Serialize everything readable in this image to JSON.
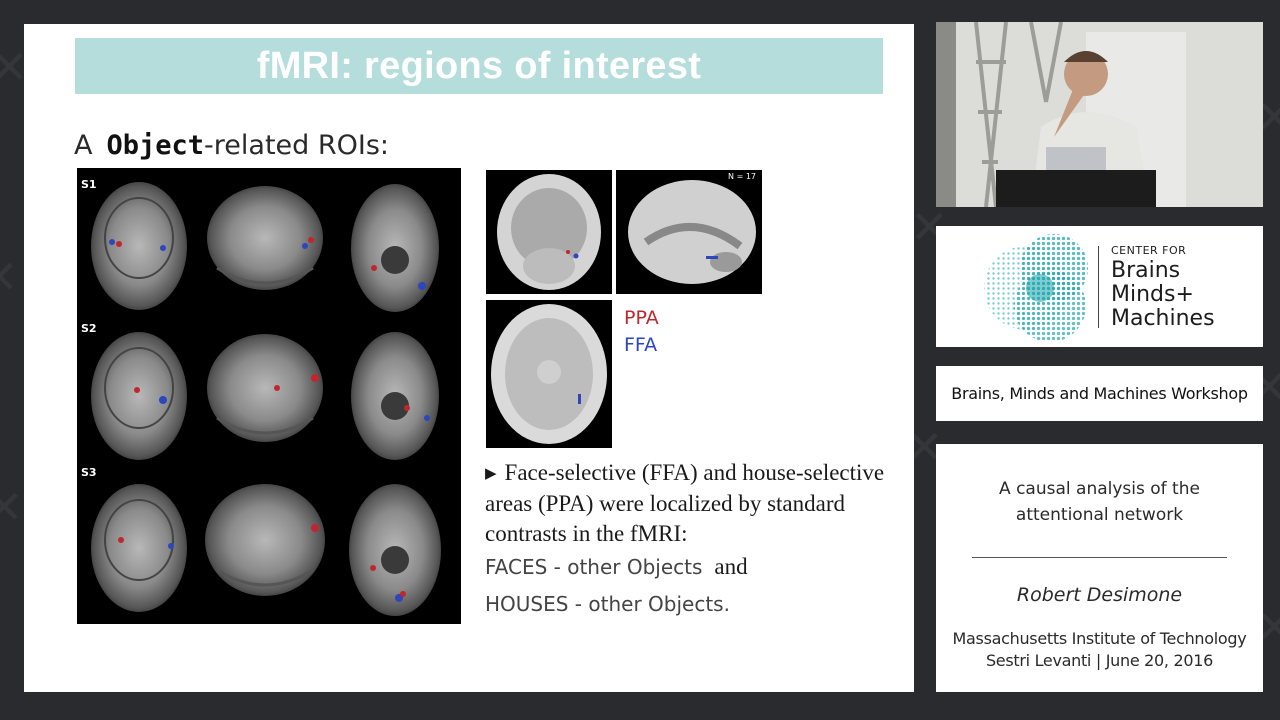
{
  "slide": {
    "title": "fMRI: regions of interest",
    "section_letter": "A",
    "section_bold": "Object",
    "section_rest": "-related ROIs:",
    "row_labels": [
      "S1",
      "S2",
      "S3"
    ],
    "n_label": "N = 17",
    "legend": {
      "ppa": "PPA",
      "ffa": "FFA"
    },
    "bullet_text": "Face-selective (FFA) and house-selective areas (PPA) were localized by standard contrasts in the fMRI:",
    "contrast_1": "FACES - other Objects",
    "contrast_and": "and",
    "contrast_2": "HOUSES - other Objects.",
    "colors": {
      "title_bar": "#b4dddc",
      "ppa": "#c0272d",
      "ffa": "#2d46b9"
    }
  },
  "sidebar": {
    "logo": {
      "line1": "CENTER FOR",
      "line2": "Brains",
      "line3": "Minds+",
      "line4": "Machines"
    },
    "workshop": "Brains, Minds and Machines Workshop",
    "talk_title": "A causal analysis of the attentional network",
    "speaker": "Robert Desimone",
    "affiliation_1": "Massachusetts Institute of Technology",
    "affiliation_2": "Sestri Levanti | June 20, 2016"
  }
}
